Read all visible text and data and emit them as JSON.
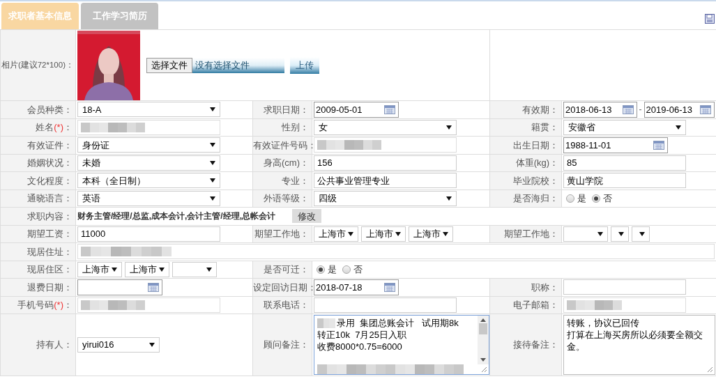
{
  "tabs": [
    {
      "label": "求职者基本信息",
      "selected": true
    },
    {
      "label": "工作学习简历",
      "selected": false
    }
  ],
  "photo": {
    "label": "相片(建议72*100)：",
    "choose_button": "选择文件",
    "file_name": "没有选择文件",
    "upload_button": "上传"
  },
  "rows": [
    {
      "cells": [
        {
          "label": "会员种类：",
          "field": {
            "kind": "select",
            "value": "18-A"
          }
        },
        {
          "label": "求职日期：",
          "field": {
            "kind": "date",
            "value": "2009-05-01"
          }
        },
        {
          "label": "有效期：",
          "field": {
            "kind": "date_range",
            "from": "2018-06-13",
            "separator": "-",
            "to": "2019-06-13"
          }
        }
      ]
    },
    {
      "cells": [
        {
          "label": "姓名",
          "required_mark": "(*)",
          "label_end": "：",
          "field": {
            "kind": "masked"
          }
        },
        {
          "label": "性别：",
          "field": {
            "kind": "select",
            "value": "女"
          }
        },
        {
          "label": "籍贯：",
          "field": {
            "kind": "select",
            "value": "安徽省"
          }
        }
      ]
    },
    {
      "cells": [
        {
          "label": "有效证件：",
          "field": {
            "kind": "select",
            "value": "身份证"
          }
        },
        {
          "label": "有效证件号码：",
          "field": {
            "kind": "masked"
          }
        },
        {
          "label": "出生日期：",
          "field": {
            "kind": "date",
            "value": "1988-11-01"
          }
        }
      ]
    },
    {
      "cells": [
        {
          "label": "婚姻状况：",
          "field": {
            "kind": "select",
            "value": "未婚"
          }
        },
        {
          "label": "身高(cm)：",
          "field": {
            "kind": "text",
            "value": "156"
          }
        },
        {
          "label": "体重(kg)：",
          "field": {
            "kind": "text",
            "value": "85"
          }
        }
      ]
    },
    {
      "cells": [
        {
          "label": "文化程度：",
          "field": {
            "kind": "select",
            "value": "本科（全日制）"
          }
        },
        {
          "label": "专业：",
          "field": {
            "kind": "text",
            "value": "公共事业管理专业"
          }
        },
        {
          "label": "毕业院校：",
          "field": {
            "kind": "text",
            "value": "黄山学院"
          }
        }
      ]
    },
    {
      "cells": [
        {
          "label": "通晓语言：",
          "field": {
            "kind": "select",
            "value": "英语"
          }
        },
        {
          "label": "外语等级：",
          "field": {
            "kind": "select",
            "value": "四级"
          }
        },
        {
          "label": "是否海归：",
          "field": {
            "kind": "radio",
            "options": [
              {
                "label": "是",
                "selected": false
              },
              {
                "label": "否",
                "selected": true
              }
            ]
          }
        }
      ]
    },
    {
      "cells": [
        {
          "label": "求职内容：",
          "wide": true,
          "field": {
            "kind": "job",
            "text": "财务主管/经理/总监,成本会计,会计主管/经理,总帐会计",
            "button": "修改"
          }
        }
      ]
    },
    {
      "cells": [
        {
          "label": "期望工资：",
          "field": {
            "kind": "text",
            "value": "11000"
          }
        },
        {
          "label": "期望工作地：",
          "field": {
            "kind": "selects",
            "items": [
              {
                "value": "上海市"
              },
              {
                "value": "上海市"
              },
              {
                "value": "上海市"
              }
            ]
          }
        },
        {
          "label": "期望工作地：",
          "field": {
            "kind": "selects",
            "items": [
              {
                "narrow": false
              },
              {
                "narrow": true
              },
              {
                "narrow": true
              }
            ]
          }
        }
      ]
    },
    {
      "cells": [
        {
          "label": "现居住址：",
          "wide": true,
          "field": {
            "kind": "masked_wide"
          }
        }
      ]
    },
    {
      "cells": [
        {
          "label": "现居住区：",
          "field": {
            "kind": "selects",
            "items": [
              {
                "value": "上海市"
              },
              {
                "value": "上海市"
              },
              {
                "narrow": false
              }
            ]
          }
        },
        {
          "label": "是否可迁：",
          "wide": true,
          "field": {
            "kind": "radio",
            "options": [
              {
                "label": "是",
                "selected": true
              },
              {
                "label": "否",
                "selected": false
              }
            ]
          }
        }
      ]
    },
    {
      "cells": [
        {
          "label": "退费日期：",
          "field": {
            "kind": "date"
          }
        },
        {
          "label": "设定回访日期：",
          "field": {
            "kind": "date",
            "value": "2018-07-18"
          }
        },
        {
          "label": "职称：",
          "field": {
            "kind": "text"
          }
        }
      ]
    },
    {
      "cells": [
        {
          "label": "手机号码",
          "required_mark": "(*)",
          "label_end": "：",
          "field": {
            "kind": "masked"
          }
        },
        {
          "label": "联系电话：",
          "field": {
            "kind": "text"
          }
        },
        {
          "label": "电子邮箱：",
          "field": {
            "kind": "masked"
          }
        }
      ]
    },
    {
      "tall": true,
      "cells": [
        {
          "label": "持有人：",
          "field": {
            "kind": "select",
            "value": "yirui016",
            "short": true
          }
        },
        {
          "label": "顾问备注：",
          "field": {
            "kind": "textarea",
            "focused": true,
            "scrollbar": true,
            "lines": [
              {
                "kind": "masked_then_text",
                "text": "录用  集团总账会计   试用期8k"
              },
              {
                "kind": "text",
                "text": "转正10k  7月25日入职"
              },
              {
                "kind": "text",
                "text": "收费8000*0.75=6000"
              },
              {
                "kind": "blank"
              },
              {
                "kind": "masked"
              }
            ]
          }
        },
        {
          "label": "接待备注：",
          "field": {
            "kind": "textarea",
            "focused": false,
            "scrollbar": false,
            "lines": [
              {
                "kind": "text",
                "text": "转账，协议已回传"
              },
              {
                "kind": "text",
                "text": "打算在上海买房所以必须要全额交金。"
              }
            ]
          }
        }
      ]
    }
  ]
}
